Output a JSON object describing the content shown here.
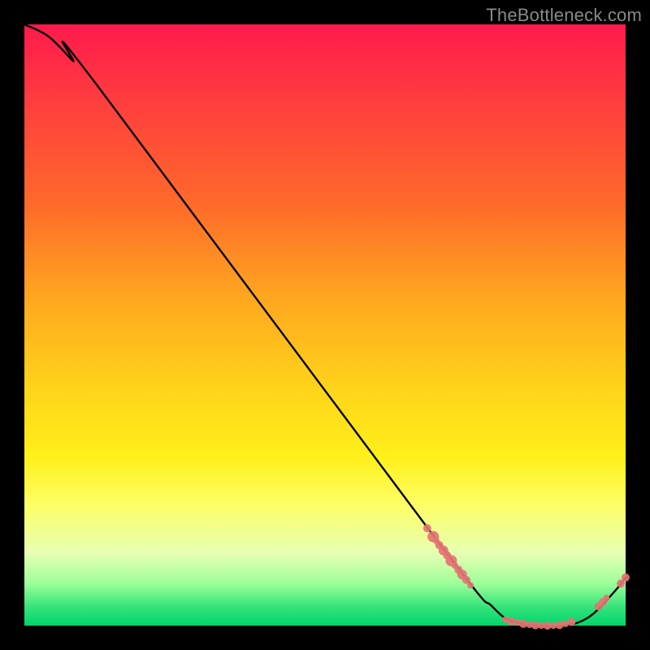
{
  "watermark": "TheBottleneck.com",
  "colors": {
    "background": "#000000",
    "curve": "#000000",
    "marker": "#e57373",
    "gradient_top": "#ff1a4d",
    "gradient_bottom": "#00d66a"
  },
  "chart_data": {
    "type": "line",
    "title": "",
    "xlabel": "",
    "ylabel": "",
    "xlim": [
      0,
      100
    ],
    "ylim": [
      0,
      100
    ],
    "grid": false,
    "legend": false,
    "series": [
      {
        "name": "bottleneck-curve",
        "x": [
          0,
          4,
          8,
          12,
          68,
          78,
          82,
          86,
          90,
          94,
          98,
          100
        ],
        "y": [
          100,
          98,
          94,
          90,
          15,
          3,
          0.5,
          0,
          0,
          1.5,
          5.5,
          8
        ]
      }
    ],
    "markers": [
      {
        "series": "descent-cluster",
        "points": [
          {
            "x": 67,
            "y": 16.2,
            "r": 5
          },
          {
            "x": 68,
            "y": 14.8,
            "r": 7
          },
          {
            "x": 68.5,
            "y": 14.1,
            "r": 4
          },
          {
            "x": 69,
            "y": 13.4,
            "r": 5
          },
          {
            "x": 69.7,
            "y": 12.5,
            "r": 6
          },
          {
            "x": 70.3,
            "y": 11.7,
            "r": 5
          },
          {
            "x": 71,
            "y": 10.8,
            "r": 7
          },
          {
            "x": 71.6,
            "y": 10.0,
            "r": 4
          },
          {
            "x": 72.2,
            "y": 9.3,
            "r": 5
          },
          {
            "x": 72.8,
            "y": 8.5,
            "r": 6
          },
          {
            "x": 73.5,
            "y": 7.6,
            "r": 5
          },
          {
            "x": 74.2,
            "y": 6.7,
            "r": 4
          }
        ]
      },
      {
        "series": "valley-cluster",
        "points": [
          {
            "x": 80,
            "y": 1.0,
            "r": 4
          },
          {
            "x": 81,
            "y": 0.7,
            "r": 5
          },
          {
            "x": 82,
            "y": 0.5,
            "r": 4
          },
          {
            "x": 83,
            "y": 0.3,
            "r": 5
          },
          {
            "x": 84,
            "y": 0.15,
            "r": 4
          },
          {
            "x": 85,
            "y": 0.05,
            "r": 5
          },
          {
            "x": 86,
            "y": 0.0,
            "r": 4
          },
          {
            "x": 87,
            "y": 0.0,
            "r": 5
          },
          {
            "x": 88,
            "y": 0.0,
            "r": 4
          },
          {
            "x": 89,
            "y": 0.1,
            "r": 5
          },
          {
            "x": 90,
            "y": 0.3,
            "r": 4
          },
          {
            "x": 91,
            "y": 0.6,
            "r": 5
          }
        ]
      },
      {
        "series": "rise-cluster",
        "points": [
          {
            "x": 95.5,
            "y": 3.2,
            "r": 5
          },
          {
            "x": 96.2,
            "y": 3.9,
            "r": 5
          },
          {
            "x": 96.8,
            "y": 4.6,
            "r": 4
          },
          {
            "x": 99.2,
            "y": 7.0,
            "r": 5
          },
          {
            "x": 100,
            "y": 8.0,
            "r": 5
          }
        ]
      }
    ]
  }
}
